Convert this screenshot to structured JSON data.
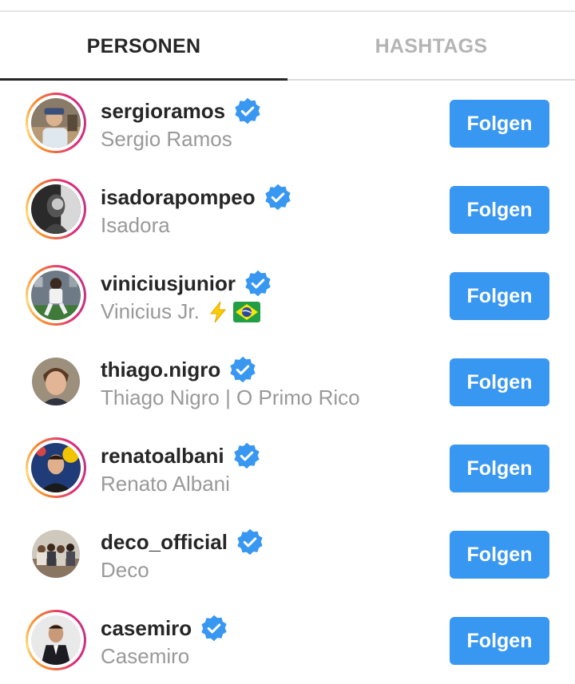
{
  "tabs": [
    {
      "label": "PERSONEN",
      "active": true
    },
    {
      "label": "HASHTAGS",
      "active": false
    }
  ],
  "accent_color": "#3897f0",
  "verified_badge_icon": "verified-badge-icon",
  "users": [
    {
      "username": "sergioramos",
      "full_name": "Sergio Ramos",
      "verified": true,
      "has_story": true,
      "button": "Folgen"
    },
    {
      "username": "isadorapompeo",
      "full_name": "Isadora",
      "verified": true,
      "has_story": true,
      "button": "Folgen"
    },
    {
      "username": "viniciusjunior",
      "full_name": "Vinicius Jr.",
      "full_name_emojis": [
        "high-voltage-emoji",
        "brazil-flag-emoji"
      ],
      "verified": true,
      "has_story": true,
      "button": "Folgen"
    },
    {
      "username": "thiago.nigro",
      "full_name": "Thiago Nigro | O Primo Rico",
      "verified": true,
      "has_story": false,
      "button": "Folgen"
    },
    {
      "username": "renatoalbani",
      "full_name": "Renato Albani",
      "verified": true,
      "has_story": true,
      "button": "Folgen"
    },
    {
      "username": "deco_official",
      "full_name": "Deco",
      "verified": true,
      "has_story": false,
      "button": "Folgen"
    },
    {
      "username": "casemiro",
      "full_name": "Casemiro",
      "verified": true,
      "has_story": true,
      "button": "Folgen"
    }
  ]
}
